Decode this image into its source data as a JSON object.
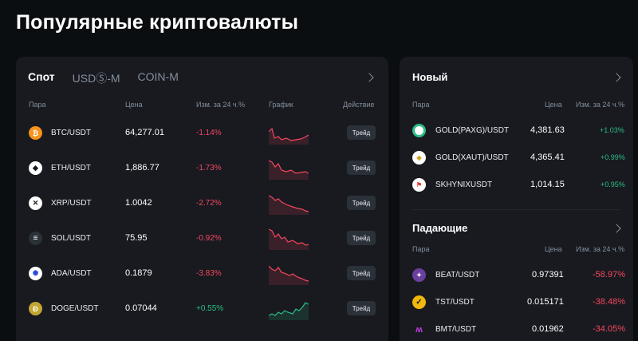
{
  "page_title": "Популярные криптовалюты",
  "spot": {
    "tabs": [
      {
        "label": "Спот",
        "active": true
      },
      {
        "label": "USDⓈ-M",
        "active": false
      },
      {
        "label": "COIN-M",
        "active": false
      }
    ],
    "headers": {
      "pair": "Пара",
      "price": "Цена",
      "change": "Изм. за 24 ч.%",
      "chart": "График",
      "action": "Действие"
    },
    "trade_label": "Трейд",
    "rows": [
      {
        "icon": "bitcoin-icon",
        "pair": "BTC/USDT",
        "price": "64,277.01",
        "change": "-1.14%",
        "trend": "down",
        "color": "#f7931a"
      },
      {
        "icon": "ethereum-icon",
        "pair": "ETH/USDT",
        "price": "1,886.77",
        "change": "-1.73%",
        "trend": "down",
        "color": "#ffffff"
      },
      {
        "icon": "xrp-icon",
        "pair": "XRP/USDT",
        "price": "1.0042",
        "change": "-2.72%",
        "trend": "down",
        "color": "#ffffff"
      },
      {
        "icon": "solana-icon",
        "pair": "SOL/USDT",
        "price": "75.95",
        "change": "-0.92%",
        "trend": "down",
        "color": "#1e2329"
      },
      {
        "icon": "cardano-icon",
        "pair": "ADA/USDT",
        "price": "0.1879",
        "change": "-3.83%",
        "trend": "down",
        "color": "#2a4ad9"
      },
      {
        "icon": "dogecoin-icon",
        "pair": "DOGE/USDT",
        "price": "0.07044",
        "change": "+0.55%",
        "trend": "up",
        "color": "#c2a633"
      }
    ]
  },
  "new": {
    "title": "Новый",
    "headers": {
      "pair": "Пара",
      "price": "Цена",
      "change": "Изм. за 24 ч.%"
    },
    "rows": [
      {
        "icon": "paxg-icon",
        "pair": "GOLD(PAXG)/USDT",
        "price": "4,381.63",
        "change": "+1.03%"
      },
      {
        "icon": "xaut-icon",
        "pair": "GOLD(XAUT)/USDT",
        "price": "4,365.41",
        "change": "+0.99%"
      },
      {
        "icon": "skhynix-icon",
        "pair": "SKHYNIXUSDT",
        "price": "1,014.15",
        "change": "+0.95%"
      }
    ]
  },
  "falling": {
    "title": "Падающие",
    "headers": {
      "pair": "Пара",
      "price": "Цена",
      "change": "Изм. за 24 ч.%"
    },
    "rows": [
      {
        "icon": "beat-icon",
        "pair": "BEAT/USDT",
        "price": "0.97391",
        "change": "-58.97%"
      },
      {
        "icon": "tst-icon",
        "pair": "TST/USDT",
        "price": "0.015171",
        "change": "-38.48%"
      },
      {
        "icon": "bmt-icon",
        "pair": "BMT/USDT",
        "price": "0.01962",
        "change": "-34.05%"
      }
    ]
  },
  "colors": {
    "up": "#2ebd85",
    "down": "#f6465d",
    "panel": "#181a20",
    "background": "#0b0e11"
  }
}
